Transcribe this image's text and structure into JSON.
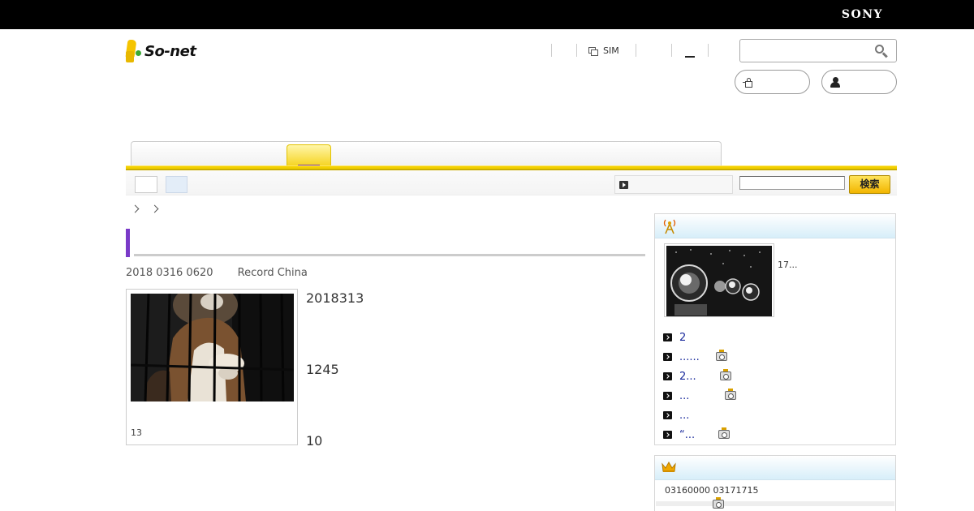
{
  "header": {
    "brand": "SONY",
    "logo_text": "So-net",
    "nav": {
      "sim_label": "SIM"
    },
    "search": {
      "placeholder": "",
      "value": ""
    }
  },
  "subnav": {
    "search_button": "検索",
    "search_value": ""
  },
  "article": {
    "date": "2018 0316 0620",
    "source": "Record China",
    "photo_caption": "13",
    "paragraphs": [
      "2018313",
      "1245",
      "10"
    ]
  },
  "sidebar": {
    "featured_text": "17...",
    "items": [
      {
        "label": "2",
        "camera": false
      },
      {
        "label": "......",
        "camera": true
      },
      {
        "label": "2...",
        "camera": true
      },
      {
        "label": "...",
        "camera": true
      },
      {
        "label": "...",
        "camera": false
      },
      {
        "label": "“...",
        "camera": true
      }
    ],
    "ranking_date": "03160000  03171715"
  },
  "colors": {
    "accent_yellow": "#f3d000",
    "title_purple": "#7a3ac8",
    "link_blue": "#1a2a9c",
    "side_header": "#d7eef9"
  }
}
